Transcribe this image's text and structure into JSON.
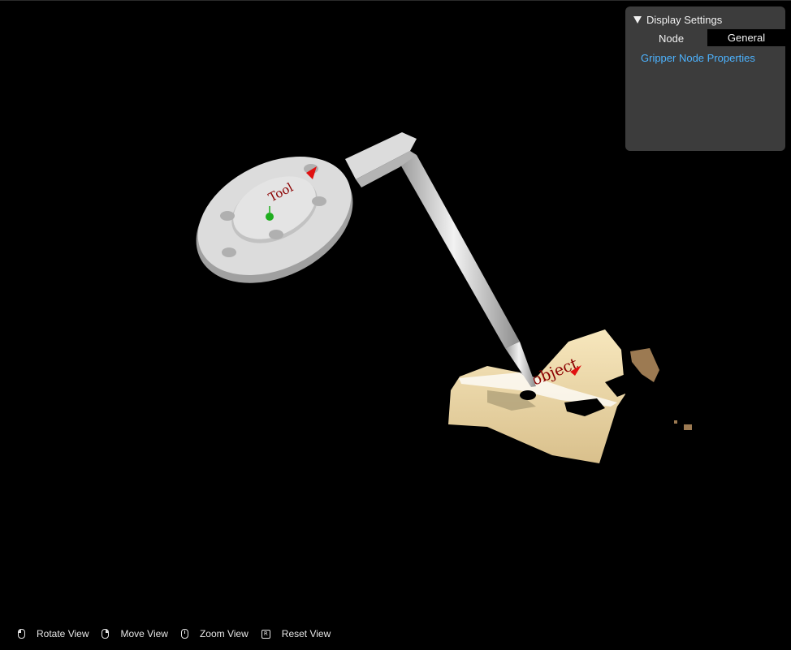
{
  "settings": {
    "header": "Display Settings",
    "node_label": "Node",
    "node_value": "General",
    "link": "Gripper Node Properties"
  },
  "scene": {
    "tool_label": "Tool",
    "object_label": "object"
  },
  "controls": [
    {
      "icon": "mouse-left-icon",
      "label": "Rotate View"
    },
    {
      "icon": "mouse-right-icon",
      "label": "Move View"
    },
    {
      "icon": "mouse-wheel-icon",
      "label": "Zoom View"
    },
    {
      "icon": "r-key-icon",
      "key": "R",
      "label": "Reset View"
    }
  ]
}
